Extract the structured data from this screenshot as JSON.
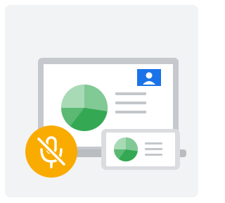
{
  "colors": {
    "card_background": "#f1f3f4",
    "laptop_frame": "#c5c8cc",
    "laptop_base": "#b9bcc1",
    "screen_background": "#ffffff",
    "screen_lines": "#c4c7ca",
    "avatar_badge": "#1a73e8",
    "pie_light": "#81c995",
    "pie_mid": "#5bb974",
    "pie_dark": "#34a853",
    "phone_frame": "#dadce0",
    "mute_badge": "#f9ab00",
    "mute_icon": "#ffffff"
  },
  "icons": {
    "profile": "account-box-icon",
    "mute": "mic-off-icon",
    "chart": "pie-chart-icon"
  }
}
